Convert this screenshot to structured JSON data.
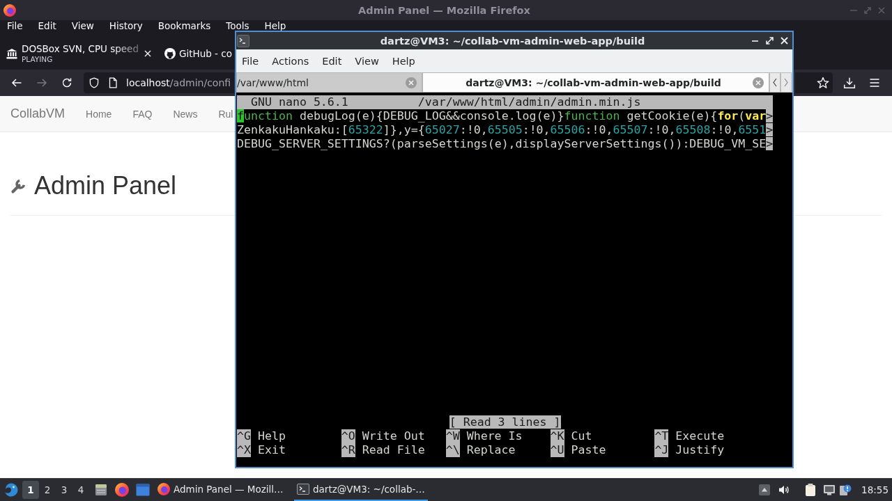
{
  "browser": {
    "title": "Admin Panel — Mozilla Firefox",
    "menu": [
      "File",
      "Edit",
      "View",
      "History",
      "Bookmarks",
      "Tools",
      "Help"
    ],
    "tabs": [
      {
        "title": "DOSBox SVN, CPU speed",
        "subtitle": "PLAYING",
        "selected": false
      },
      {
        "title": "GitHub - co",
        "selected": false
      }
    ],
    "nav_buttons": [
      {
        "kind": "back",
        "disabled": false
      },
      {
        "kind": "forward",
        "disabled": true
      },
      {
        "kind": "reload",
        "disabled": false
      }
    ],
    "url": {
      "host": "localhost",
      "path": "/admin/confi"
    }
  },
  "page": {
    "brand": "CollabVM",
    "links": [
      "Home",
      "FAQ",
      "News",
      "Rul"
    ],
    "heading": "Admin Panel"
  },
  "terminal": {
    "title": "dartz@VM3: ~/collab-vm-admin-web-app/build",
    "menu": [
      "File",
      "Actions",
      "Edit",
      "View",
      "Help"
    ],
    "tabs": [
      {
        "label": "/var/www/html",
        "selected": false
      },
      {
        "label": "dartz@VM3: ~/collab-vm-admin-web-app/build",
        "selected": true
      }
    ],
    "nano": {
      "version": "GNU nano 5.6.1",
      "filename": "/var/www/html/admin/admin.min.js",
      "lines": [
        [
          {
            "kind": "cursor",
            "text": "f"
          },
          {
            "kind": "keyword",
            "text": "unction"
          },
          {
            "kind": "plain",
            "text": " debugLog(e){DEBUG_LOG&&console.log(e)}"
          },
          {
            "kind": "keyword",
            "text": "function"
          },
          {
            "kind": "plain",
            "text": " getCookie(e){"
          },
          {
            "kind": "control",
            "text": "for"
          },
          {
            "kind": "plain",
            "text": "("
          },
          {
            "kind": "control",
            "text": "var"
          },
          {
            "kind": "overflow",
            "text": ">"
          }
        ],
        [
          {
            "kind": "plain",
            "text": "ZenkakuHankaku:["
          },
          {
            "kind": "number",
            "text": "65322"
          },
          {
            "kind": "plain",
            "text": "]},y={"
          },
          {
            "kind": "number",
            "text": "65027"
          },
          {
            "kind": "plain",
            "text": ":!0,"
          },
          {
            "kind": "number",
            "text": "65505"
          },
          {
            "kind": "plain",
            "text": ":!0,"
          },
          {
            "kind": "number",
            "text": "65506"
          },
          {
            "kind": "plain",
            "text": ":!0,"
          },
          {
            "kind": "number",
            "text": "65507"
          },
          {
            "kind": "plain",
            "text": ":!0,"
          },
          {
            "kind": "number",
            "text": "65508"
          },
          {
            "kind": "plain",
            "text": ":!0,"
          },
          {
            "kind": "number",
            "text": "6551"
          },
          {
            "kind": "overflow",
            "text": ">"
          }
        ],
        [
          {
            "kind": "plain",
            "text": "DEBUG_SERVER_SETTINGS?(parseSettings(e),displayServerSettings()):DEBUG_VM_SE"
          },
          {
            "kind": "overflow",
            "text": ">"
          }
        ]
      ],
      "status": "[ Read 3 lines ]",
      "shortcuts": [
        [
          {
            "key": "^G",
            "label": "Help"
          },
          {
            "key": "^O",
            "label": "Write Out"
          },
          {
            "key": "^W",
            "label": "Where Is"
          },
          {
            "key": "^K",
            "label": "Cut"
          },
          {
            "key": "^T",
            "label": "Execute"
          }
        ],
        [
          {
            "key": "^X",
            "label": "Exit"
          },
          {
            "key": "^R",
            "label": "Read File"
          },
          {
            "key": "^\\",
            "label": "Replace"
          },
          {
            "key": "^U",
            "label": "Paste"
          },
          {
            "key": "^J",
            "label": "Justify"
          }
        ]
      ]
    }
  },
  "taskbar": {
    "workspaces": [
      {
        "label": "1",
        "selected": true
      },
      {
        "label": "2",
        "selected": false
      },
      {
        "label": "3",
        "selected": false
      },
      {
        "label": "4",
        "selected": false
      }
    ],
    "tasks": [
      {
        "label": "Admin Panel — Mozill…",
        "selected": false
      },
      {
        "label": "dartz@VM3: ~/collab-…",
        "selected": true
      }
    ],
    "clock": "18:55"
  }
}
